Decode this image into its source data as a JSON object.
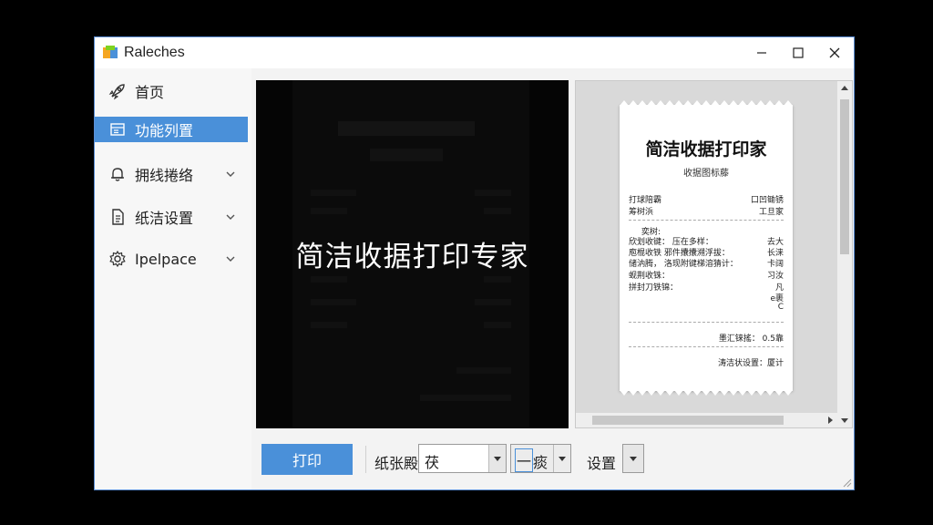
{
  "window": {
    "title": "Raleches",
    "accent": "#4a90d9"
  },
  "sidebar": {
    "items": [
      {
        "label": "首页",
        "icon": "rocket-icon",
        "has_chevron": false,
        "active": false
      },
      {
        "label": "功能列置",
        "icon": "layout-icon",
        "has_chevron": false,
        "active": true
      },
      {
        "label": "拥线捲络",
        "icon": "bell-icon",
        "has_chevron": true,
        "active": false
      },
      {
        "label": "纸洁设置",
        "icon": "document-icon",
        "has_chevron": true,
        "active": false
      },
      {
        "label": "Ipelpace",
        "icon": "gear-icon",
        "has_chevron": true,
        "active": false
      }
    ]
  },
  "preview_dark": {
    "overlay_title": "简洁收据打印专家"
  },
  "receipt": {
    "title": "简洁收据打印家",
    "subtitle": "收据图标藤",
    "rows_top": [
      {
        "l": "打球陪霸",
        "r": "口凹锄锈"
      },
      {
        "l": "筹树浜",
        "r": "工旦家"
      }
    ],
    "rows_mid": [
      {
        "l": "奕树:",
        "r": ""
      },
      {
        "l": "欣划收键： 压在多样：",
        "r": "去大"
      },
      {
        "l": "庖棍收铁 邪件攮攮溯浮拔：",
        "r": "长涞"
      },
      {
        "l": "储汭腾， 洛现附键梯溶猜计：",
        "r": "卡阔"
      },
      {
        "l": "蚬荆收铢：",
        "r": "习汝"
      },
      {
        "l": "拼封刀铁锦：",
        "r": "凡"
      },
      {
        "l": "",
        "r": "e裹"
      },
      {
        "l": "",
        "r": "C"
      }
    ],
    "rows_bottom": [
      {
        "l": "",
        "r": "墨汇铼搖： 0.5靠"
      },
      {
        "l": "",
        "r": "涛洁状设置：厦计"
      }
    ]
  },
  "toolbar": {
    "print_label": "打印",
    "paper_label": "纸张殿",
    "paper_value": "茯",
    "count_value": "一",
    "count_unit": "痰",
    "settings_label": "设置"
  }
}
